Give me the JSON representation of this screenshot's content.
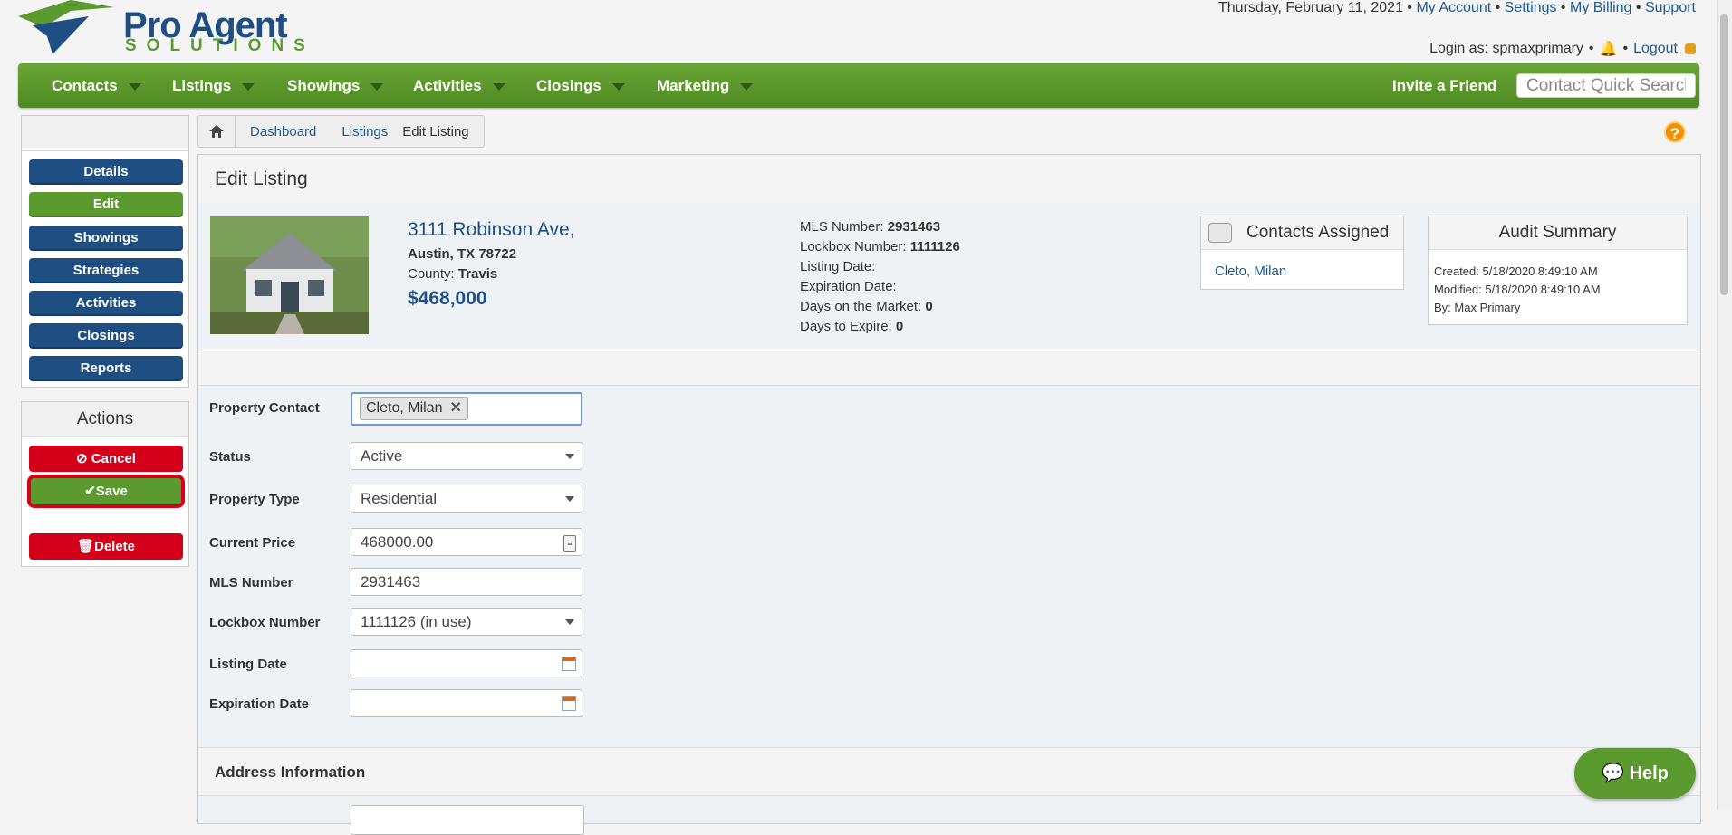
{
  "header": {
    "logo_line1": "Pro Agent",
    "logo_line2": "SOLUTIONS",
    "date": "Thursday, February 11, 2021",
    "links": [
      "My Account",
      "Settings",
      "My Billing",
      "Support"
    ],
    "login_label": "Login as: spmaxprimary",
    "logout": "Logout"
  },
  "nav": {
    "items": [
      "Contacts",
      "Listings",
      "Showings",
      "Activities",
      "Closings",
      "Marketing"
    ],
    "invite": "Invite a Friend",
    "search_placeholder": "Contact Quick Search"
  },
  "sidebar": {
    "items": [
      "Details",
      "Edit",
      "Showings",
      "Strategies",
      "Activities",
      "Closings",
      "Reports"
    ],
    "active": "Edit",
    "actions_title": "Actions",
    "cancel": "Cancel",
    "save": "Save",
    "delete": "Delete"
  },
  "breadcrumb": [
    "Dashboard",
    "Listings",
    "Edit Listing"
  ],
  "page": {
    "title": "Edit Listing",
    "address_line1": "3111 Robinson Ave,",
    "address_line2": "Austin, TX 78722",
    "county_label": "County:",
    "county": "Travis",
    "price": "$468,000",
    "mls_label": "MLS Number:",
    "mls": "2931463",
    "lockbox_label": "Lockbox Number:",
    "lockbox": "1111126",
    "listing_date_label": "Listing Date:",
    "expiration_label": "Expiration Date:",
    "dom_label": "Days on the Market:",
    "dom": "0",
    "dte_label": "Days to Expire:",
    "dte": "0"
  },
  "contacts_box": {
    "title": "Contacts Assigned",
    "contact": "Cleto, Milan"
  },
  "audit_box": {
    "title": "Audit Summary",
    "created": "Created: 5/18/2020 8:49:10 AM",
    "modified": "Modified: 5/18/2020 8:49:10 AM",
    "by": "By: Max Primary"
  },
  "form": {
    "property_contact_label": "Property Contact",
    "property_contact_tag": "Cleto, Milan",
    "status_label": "Status",
    "status": "Active",
    "property_type_label": "Property Type",
    "property_type": "Residential",
    "current_price_label": "Current Price",
    "current_price": "468000.00",
    "mls_label": "MLS Number",
    "mls": "2931463",
    "lockbox_label": "Lockbox Number",
    "lockbox": "1111126 (in use)",
    "listing_date_label": "Listing Date",
    "listing_date": "",
    "expiration_date_label": "Expiration Date",
    "expiration_date": ""
  },
  "address_section": "Address Information",
  "help_button": "Help",
  "colors": {
    "brand_green": "#5a9a2e",
    "brand_blue": "#1f4f82",
    "danger_red": "#d4001a"
  }
}
